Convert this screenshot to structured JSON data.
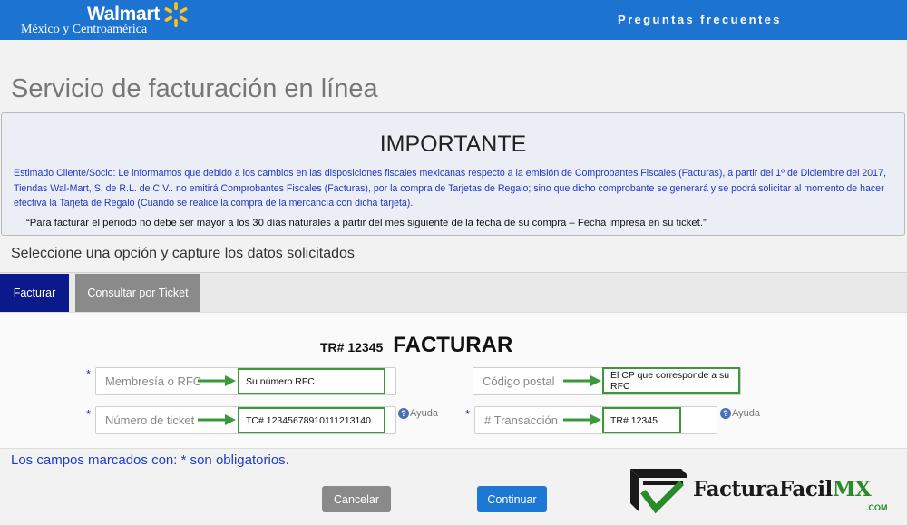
{
  "header": {
    "brand_name": "Walmart",
    "brand_subtitle": "México y Centroamérica",
    "faq_link": "Preguntas frecuentes",
    "logo_icon": "spark-icon",
    "color": "#1d74d0"
  },
  "page_title": "Servicio de facturación en línea",
  "notice": {
    "heading": "IMPORTANTE",
    "body": "Estimado Cliente/Socio: Le informamos que debido a los cambios en las disposiciones fiscales mexicanas respecto a la emisión de Comprobantes Fiscales (Facturas), a partir del 1º de Diciembre del 2017, Tiendas Wal-Mart, S. de R.L. de C.V.. no emitirá Comprobantes Fiscales (Facturas), por la compra de Tarjetas de Regalo; sino que dicho comprobante se generará y se podrá solicitar al momento de hacer efectiva la Tarjeta de Regalo (Cuando se realice la compra de la mercancía con dicha tarjeta).",
    "quote": "“Para facturar el periodo no debe ser mayor a los 30 días naturales a partir del mes siguiente de la fecha de su compra – Fecha impresa en su ticket.”"
  },
  "instructions": "Seleccione una opción y capture los datos solicitados",
  "tabs": [
    {
      "label": "Facturar",
      "active": true
    },
    {
      "label": "Consultar por Ticket",
      "active": false
    }
  ],
  "form": {
    "tr_label": "TR# 12345",
    "title": "FACTURAR",
    "required_mark": "*",
    "fields": {
      "rfc": {
        "placeholder": "Membresía o RFC",
        "hint": "Su número RFC"
      },
      "postal": {
        "placeholder": "Código postal",
        "hint": "El CP que corresponde a su RFC"
      },
      "ticket": {
        "placeholder": "Número de ticket",
        "hint": "TC# 12345678910111213140"
      },
      "transaction": {
        "placeholder": "# Transacción",
        "hint": "TR# 12345"
      }
    },
    "help_label": "Ayuda",
    "help_icon": "?"
  },
  "required_note": "Los campos marcados con: * son obligatorios.",
  "buttons": {
    "cancel": "Cancelar",
    "continue": "Continuar"
  },
  "watermark": {
    "name": "FacturaFacil",
    "accent": "MX",
    "domain": ".COM"
  },
  "colors": {
    "accent_blue": "#1d74d0",
    "tab_active": "#0b1a8b",
    "hint_green": "#3a9a3a",
    "notice_text": "#1f36c4"
  }
}
